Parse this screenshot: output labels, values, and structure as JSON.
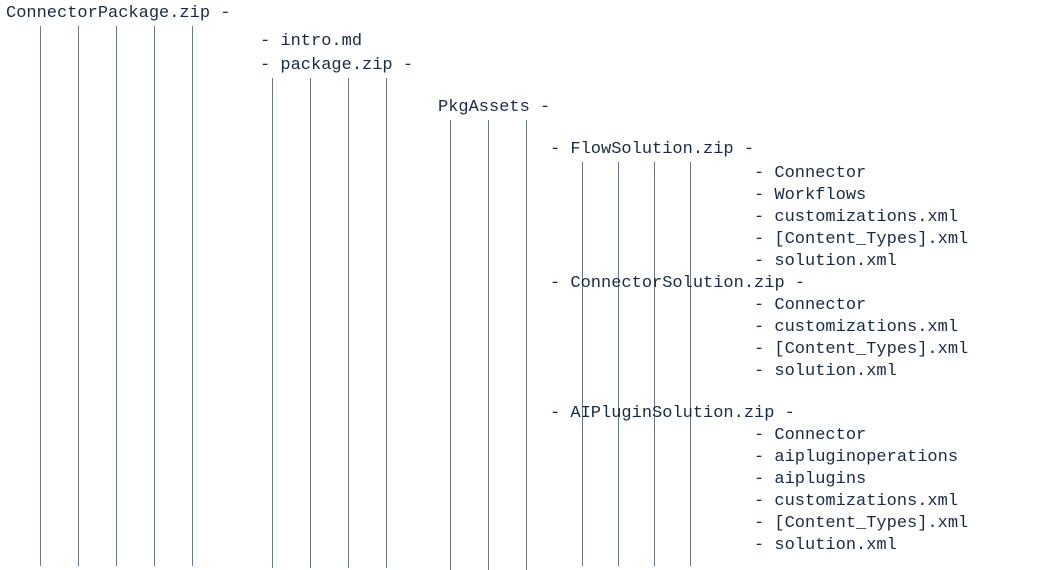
{
  "root": {
    "name": "ConnectorPackage.zip",
    "suffix": " -"
  },
  "level1": {
    "intro": {
      "prefix": "- ",
      "name": "intro.md"
    },
    "package": {
      "prefix": "- ",
      "name": "package.zip",
      "suffix": "  -"
    }
  },
  "level2": {
    "pkgassets": {
      "name": "PkgAssets",
      "suffix": " -"
    }
  },
  "level3": {
    "flow": {
      "prefix": "- ",
      "name": "FlowSolution.zip",
      "suffix": " -"
    },
    "connector": {
      "prefix": "- ",
      "name": "ConnectorSolution.zip",
      "suffix": " -"
    },
    "aiplugin": {
      "prefix": "- ",
      "name": "AIPluginSolution.zip",
      "suffix": " -"
    }
  },
  "flow_children": {
    "c0": {
      "prefix": "- ",
      "name": "Connector"
    },
    "c1": {
      "prefix": "- ",
      "name": "Workflows"
    },
    "c2": {
      "prefix": "- ",
      "name": "customizations.xml"
    },
    "c3": {
      "prefix": "- ",
      "name": "[Content_Types].xml"
    },
    "c4": {
      "prefix": "- ",
      "name": "solution.xml"
    }
  },
  "connector_children": {
    "c0": {
      "prefix": "- ",
      "name": "Connector"
    },
    "c1": {
      "prefix": "- ",
      "name": "customizations.xml"
    },
    "c2": {
      "prefix": "- ",
      "name": "[Content_Types].xml"
    },
    "c3": {
      "prefix": "- ",
      "name": "solution.xml"
    }
  },
  "aiplugin_children": {
    "c0": {
      "prefix": "- ",
      "name": "Connector"
    },
    "c1": {
      "prefix": "- ",
      "name": "aipluginoperations"
    },
    "c2": {
      "prefix": "- ",
      "name": "aiplugins"
    },
    "c3": {
      "prefix": "- ",
      "name": "customizations.xml"
    },
    "c4": {
      "prefix": "- ",
      "name": "[Content_Types].xml"
    },
    "c5": {
      "prefix": "- ",
      "name": "solution.xml"
    }
  }
}
